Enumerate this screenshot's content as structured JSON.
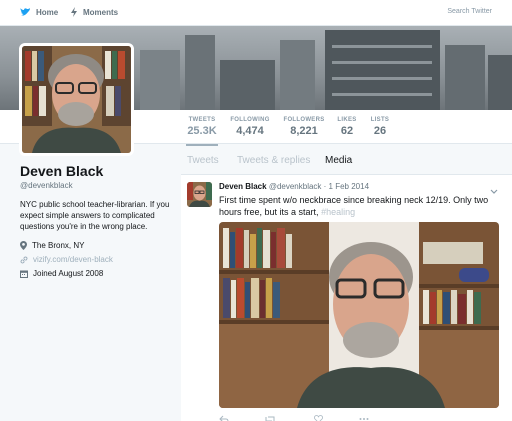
{
  "nav": {
    "home": "Home",
    "moments": "Moments",
    "search_placeholder": "Search Twitter"
  },
  "stats": [
    {
      "label": "TWEETS",
      "value": "25.3K"
    },
    {
      "label": "FOLLOWING",
      "value": "4,474"
    },
    {
      "label": "FOLLOWERS",
      "value": "8,221"
    },
    {
      "label": "LIKES",
      "value": "62"
    },
    {
      "label": "LISTS",
      "value": "26"
    }
  ],
  "profile": {
    "name": "Deven Black",
    "handle": "@devenkblack",
    "bio": "NYC public school teacher-librarian. If you expect simple answers to complicated questions you're in the wrong place.",
    "location": "The Bronx, NY",
    "website": "vizify.com/deven-black",
    "joined": "Joined August 2008"
  },
  "tabs": [
    {
      "label": "Tweets"
    },
    {
      "label": "Tweets & replies"
    },
    {
      "label": "Media"
    }
  ],
  "tweet": {
    "name": "Deven Black",
    "handle": "@devenkblack",
    "date": "· 1 Feb 2014",
    "text": "First time spent w/o neckbrace since breaking neck 12/19. Only two hours free, but its a start,",
    "hashtag": "#healing"
  },
  "colors": {
    "brand": "#1da1f2",
    "muted": "#66757f",
    "faded": "#9fb0bc"
  },
  "icons": {
    "home": "home-icon",
    "moments": "lightning-icon",
    "location": "pin-icon",
    "link": "link-icon",
    "calendar": "calendar-icon"
  }
}
